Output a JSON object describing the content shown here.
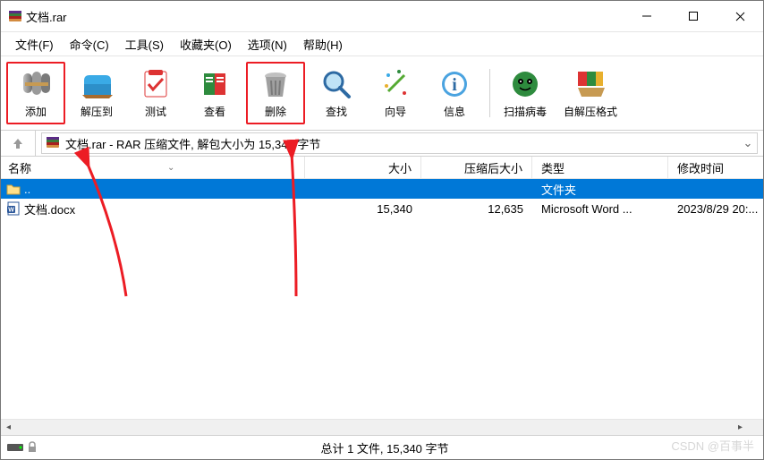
{
  "title": "文档.rar",
  "menu": {
    "file": "文件(F)",
    "cmd": "命令(C)",
    "tool": "工具(S)",
    "fav": "收藏夹(O)",
    "opt": "选项(N)",
    "help": "帮助(H)"
  },
  "toolbar": {
    "add": "添加",
    "extract": "解压到",
    "test": "测试",
    "view": "查看",
    "delete": "删除",
    "find": "查找",
    "wizard": "向导",
    "info": "信息",
    "scan": "扫描病毒",
    "sfx": "自解压格式"
  },
  "path": "文档.rar - RAR 压缩文件, 解包大小为 15,340 字节",
  "columns": {
    "name": "名称",
    "size": "大小",
    "packed": "压缩后大小",
    "type": "类型",
    "date": "修改时间"
  },
  "rows": [
    {
      "name": "..",
      "size": "",
      "packed": "",
      "type": "文件夹",
      "date": ""
    },
    {
      "name": "文档.docx",
      "size": "15,340",
      "packed": "12,635",
      "type": "Microsoft Word ...",
      "date": "2023/8/29 20:..."
    }
  ],
  "status": "总计 1 文件, 15,340 字节",
  "watermark": "CSDN @百事半"
}
